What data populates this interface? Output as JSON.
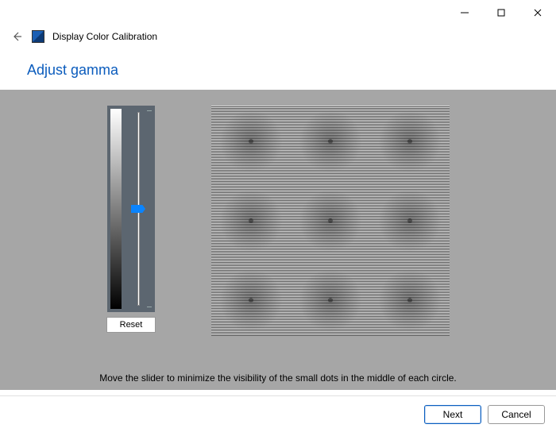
{
  "window": {
    "app_title": "Display Color Calibration"
  },
  "page": {
    "title": "Adjust gamma",
    "hint": "Move the slider to minimize the visibility of the small dots in the middle of each circle."
  },
  "slider": {
    "reset_label": "Reset",
    "value_percent": 50
  },
  "buttons": {
    "next": "Next",
    "cancel": "Cancel"
  }
}
